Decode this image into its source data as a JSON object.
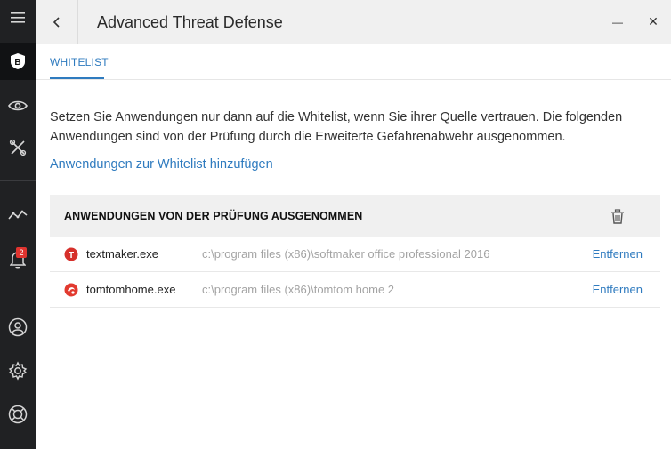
{
  "window": {
    "title": "Advanced Threat Defense",
    "minimize_glyph": "—",
    "close_glyph": "✕"
  },
  "sidebar": {
    "items": [
      {
        "icon": "hamburger-menu-icon"
      },
      {
        "icon": "bitdefender-logo-icon",
        "active": true
      },
      {
        "icon": "eye-icon"
      },
      {
        "icon": "tools-icon"
      },
      {
        "icon": "activity-graph-icon"
      },
      {
        "icon": "bell-icon",
        "badge": "2"
      },
      {
        "icon": "account-icon"
      },
      {
        "icon": "gear-icon"
      },
      {
        "icon": "lifebuoy-icon"
      }
    ]
  },
  "tabs": [
    {
      "label": "WHITELIST",
      "active": true
    }
  ],
  "description": "Setzen Sie Anwendungen nur dann auf die Whitelist, wenn Sie ihrer Quelle vertrauen. Die folgenden Anwendungen sind von der Prüfung durch die Erweiterte Gefahrenabwehr ausgenommen.",
  "add_link": "Anwendungen zur Whitelist hinzufügen",
  "list": {
    "header": "ANWENDUNGEN VON DER PRÜFUNG AUSGENOMMEN",
    "rows": [
      {
        "name": "textmaker.exe",
        "path": "c:\\program files (x86)\\softmaker office professional 2016",
        "action": "Entfernen",
        "icon": "textmaker-app-icon"
      },
      {
        "name": "tomtomhome.exe",
        "path": "c:\\program files (x86)\\tomtom home 2",
        "action": "Entfernen",
        "icon": "tomtom-app-icon"
      }
    ]
  },
  "colors": {
    "accent": "#2f7bbf",
    "sidebar_bg": "#202123",
    "badge": "#e0342f"
  }
}
